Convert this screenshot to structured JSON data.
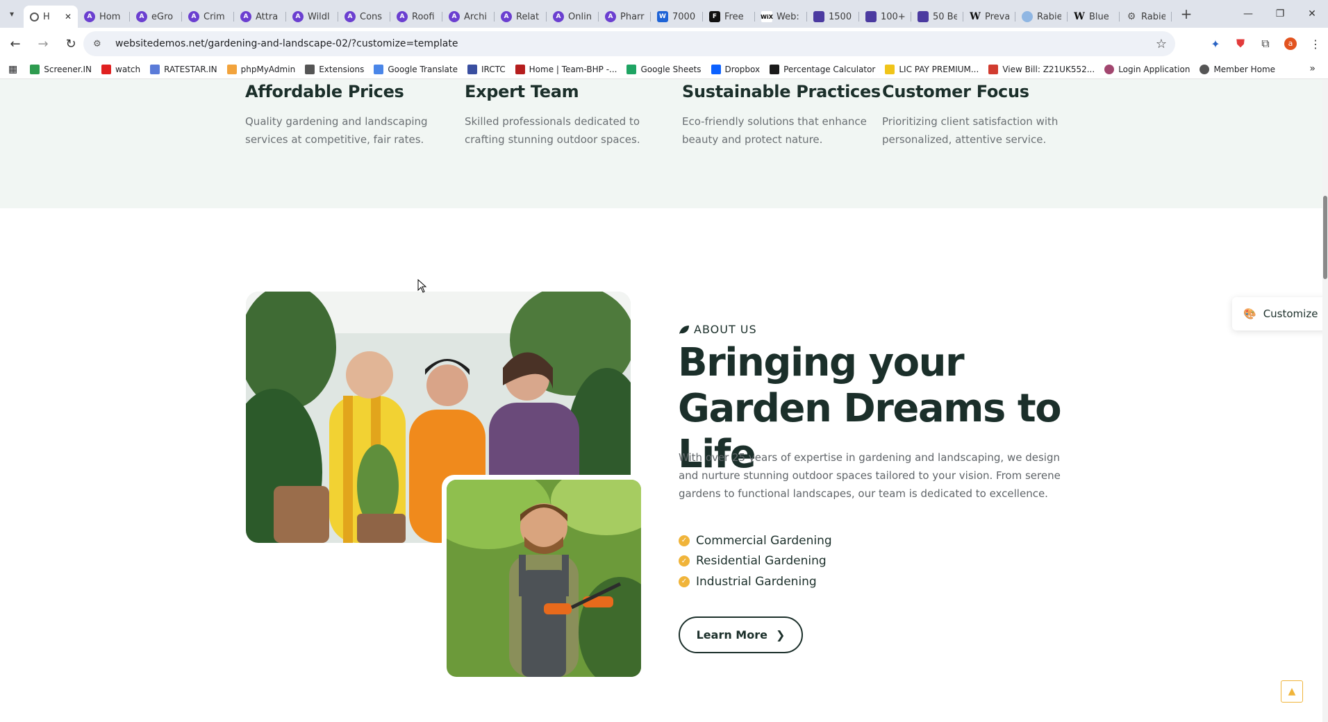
{
  "browser": {
    "tabs": [
      {
        "label": "H",
        "icon": "page-icon",
        "active": true
      },
      {
        "label": "Hom",
        "icon": "astra-icon"
      },
      {
        "label": "eGro",
        "icon": "astra-icon"
      },
      {
        "label": "Crim",
        "icon": "astra-icon"
      },
      {
        "label": "Attra",
        "icon": "astra-icon"
      },
      {
        "label": "Wildl",
        "icon": "astra-icon"
      },
      {
        "label": "Cons",
        "icon": "astra-icon"
      },
      {
        "label": "Roofi",
        "icon": "astra-icon"
      },
      {
        "label": "Archi",
        "icon": "astra-icon"
      },
      {
        "label": "Relat",
        "icon": "astra-icon"
      },
      {
        "label": "Onlin",
        "icon": "astra-icon"
      },
      {
        "label": "Pharr",
        "icon": "astra-icon"
      },
      {
        "label": "7000",
        "icon": "blue-square-icon"
      },
      {
        "label": "Free",
        "icon": "flag-icon"
      },
      {
        "label": "Web:",
        "icon": "wix-icon"
      },
      {
        "label": "1500",
        "icon": "canva-icon"
      },
      {
        "label": "100+",
        "icon": "canva-icon"
      },
      {
        "label": "50 Be",
        "icon": "canva-icon"
      },
      {
        "label": "Preva",
        "icon": "wikipedia-icon"
      },
      {
        "label": "Rabie",
        "icon": "globe-icon"
      },
      {
        "label": "Blue",
        "icon": "wikipedia-icon"
      },
      {
        "label": "Rabie",
        "icon": "gear-icon"
      }
    ],
    "url": "websitedemos.net/gardening-and-landscape-02/?customize=template",
    "bookmarks": [
      {
        "label": "Screener.IN",
        "color": "#2e9b4f"
      },
      {
        "label": "watch",
        "color": "#e02020"
      },
      {
        "label": "RATESTAR.IN",
        "color": "#5a7bd8"
      },
      {
        "label": "phpMyAdmin",
        "color": "#f2a33c"
      },
      {
        "label": "Extensions",
        "color": "#555555"
      },
      {
        "label": "Google Translate",
        "color": "#4a86e8"
      },
      {
        "label": "IRCTC",
        "color": "#3a4fa0"
      },
      {
        "label": "Home | Team-BHP -...",
        "color": "#b51d1d"
      },
      {
        "label": "Google Sheets",
        "color": "#1fa463"
      },
      {
        "label": "Dropbox",
        "color": "#0b61ff"
      },
      {
        "label": "Percentage Calculator",
        "color": "#1a1a1a"
      },
      {
        "label": "LIC PAY PREMIUM...",
        "color": "#f0c419"
      },
      {
        "label": "View Bill: Z21UK552...",
        "color": "#d13b2f"
      },
      {
        "label": "Login Application",
        "color": "#a2466f"
      },
      {
        "label": "Member Home",
        "color": "#555555"
      }
    ]
  },
  "features": [
    {
      "title": "Affordable Prices",
      "text": "Quality gardening and landscaping services at competitive, fair rates."
    },
    {
      "title": "Expert Team",
      "text": "Skilled professionals dedicated to crafting stunning outdoor spaces."
    },
    {
      "title": "Sustainable Practices",
      "text": "Eco-friendly solutions that enhance beauty and protect nature."
    },
    {
      "title": "Customer Focus",
      "text": "Prioritizing client satisfaction with personalized, attentive service."
    }
  ],
  "about": {
    "eyebrow": "ABOUT US",
    "headline": "Bringing your Garden Dreams to Life",
    "body": "With over 25 years of expertise in gardening and landscaping, we design and nurture stunning outdoor spaces tailored to your vision. From serene gardens to functional landscapes, our team is dedicated to excellence.",
    "checklist": [
      "Commercial Gardening",
      "Residential Gardening",
      "Industrial Gardening"
    ],
    "cta": "Learn More"
  },
  "customize_label": "Customize",
  "colors": {
    "accent": "#f0b43a",
    "heading": "#1b2f2a",
    "feature_bg": "#f1f6f3"
  }
}
